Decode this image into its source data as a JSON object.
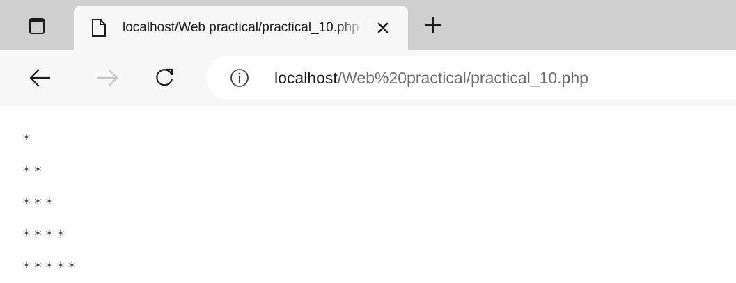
{
  "tab": {
    "title": "localhost/Web practical/practical_10.php"
  },
  "address": {
    "host": "localhost",
    "path": "/Web%20practical/practical_10.php"
  },
  "content": {
    "rows": [
      "*",
      "* *",
      "* * *",
      "* * * *",
      "* * * * *"
    ]
  }
}
